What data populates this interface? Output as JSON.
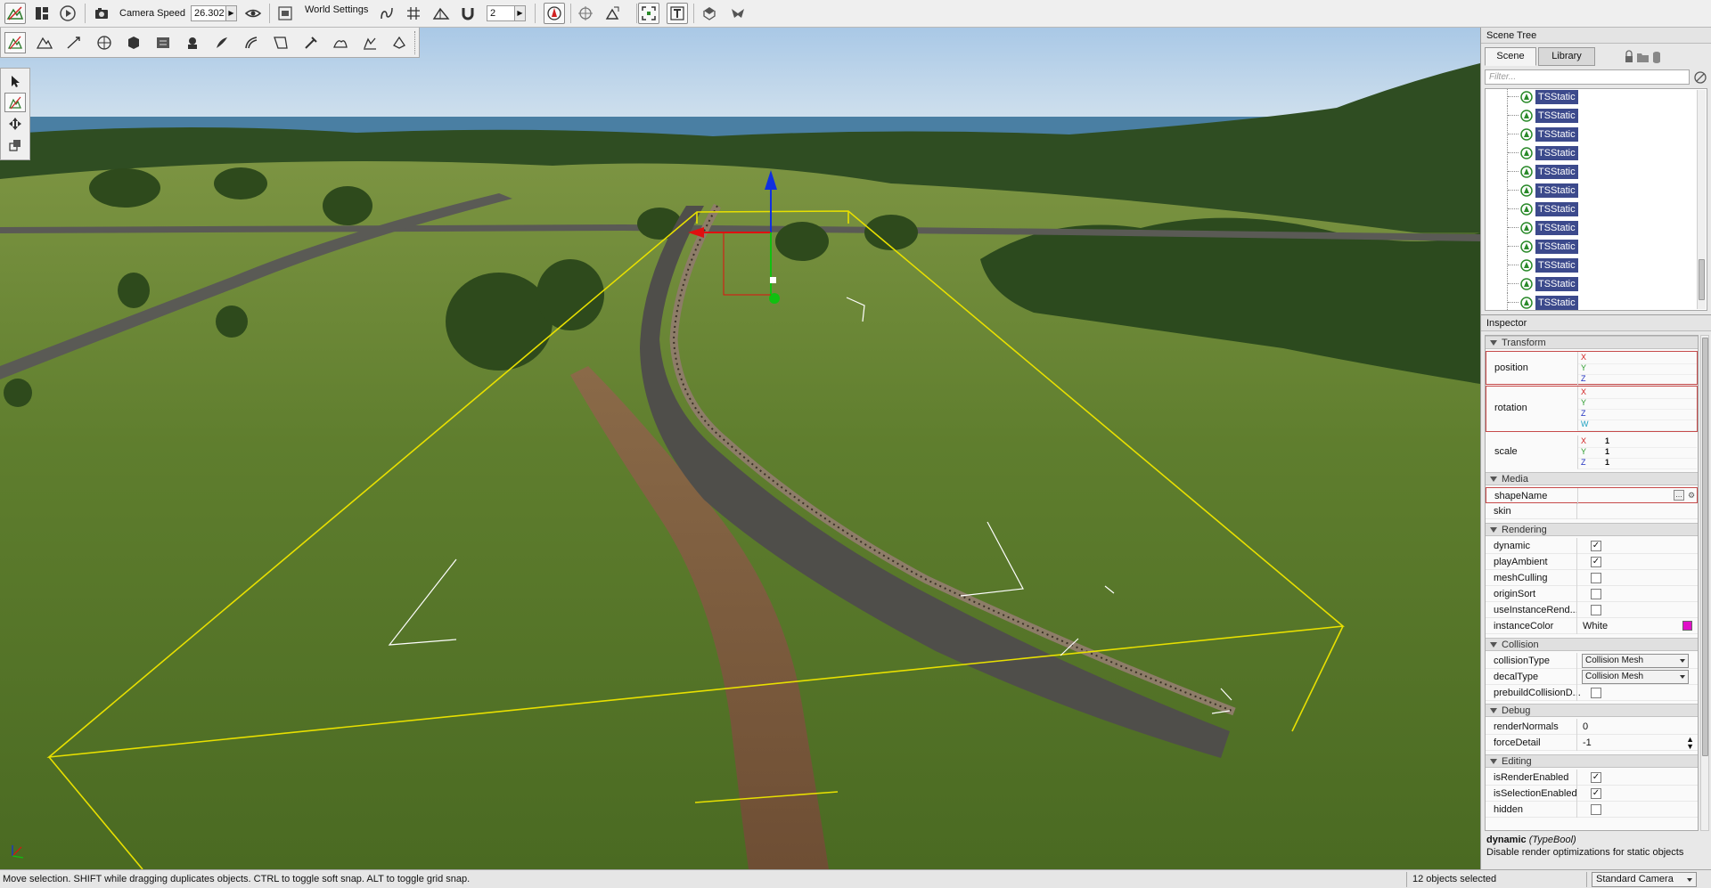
{
  "toolbar": {
    "camera_speed_label": "Camera Speed",
    "camera_speed_value": "26.302",
    "world_settings_label": "World Settings",
    "snap_value": "2"
  },
  "scene_tree": {
    "title": "Scene Tree",
    "tabs": [
      "Scene",
      "Library"
    ],
    "filter_placeholder": "Filter...",
    "items": [
      "TSStatic",
      "TSStatic",
      "TSStatic",
      "TSStatic",
      "TSStatic",
      "TSStatic",
      "TSStatic",
      "TSStatic",
      "TSStatic",
      "TSStatic",
      "TSStatic",
      "TSStatic"
    ]
  },
  "inspector": {
    "title": "Inspector",
    "sections": {
      "transform": "Transform",
      "media": "Media",
      "rendering": "Rendering",
      "collision": "Collision",
      "debug": "Debug",
      "editing": "Editing"
    },
    "position": {
      "label": "position",
      "x": "",
      "y": "",
      "z": ""
    },
    "rotation": {
      "label": "rotation",
      "x": "",
      "y": "",
      "z": "",
      "w": ""
    },
    "scale": {
      "label": "scale",
      "x": "1",
      "y": "1",
      "z": "1"
    },
    "axis_labels": {
      "x": "X",
      "y": "Y",
      "z": "Z",
      "w": "W"
    },
    "media": {
      "shape_name_label": "shapeName",
      "shape_name_value": "",
      "skin_label": "skin",
      "skin_value": ""
    },
    "rendering": {
      "dynamic_label": "dynamic",
      "dynamic": true,
      "play_ambient_label": "playAmbient",
      "play_ambient": true,
      "mesh_culling_label": "meshCulling",
      "mesh_culling": false,
      "origin_sort_label": "originSort",
      "origin_sort": false,
      "use_instance_render_label": "useInstanceRend...",
      "use_instance_render": false,
      "instance_color_label": "instanceColor",
      "instance_color_value": "White",
      "instance_color_swatch": "#e010c8"
    },
    "collision": {
      "collision_type_label": "collisionType",
      "collision_type_value": "Collision Mesh",
      "decal_type_label": "decalType",
      "decal_type_value": "Collision Mesh",
      "prebuild_label": "prebuildCollisionD...",
      "prebuild": false
    },
    "debug": {
      "render_normals_label": "renderNormals",
      "render_normals_value": "0",
      "force_detail_label": "forceDetail",
      "force_detail_value": "-1"
    },
    "editing": {
      "is_render_enabled_label": "isRenderEnabled",
      "is_render_enabled": true,
      "is_selection_enabled_label": "isSelectionEnabled",
      "is_selection_enabled": true,
      "hidden_label": "hidden",
      "hidden": false
    },
    "description": {
      "name": "dynamic",
      "type": "(TypeBool)",
      "text": "Disable render optimizations for static objects"
    }
  },
  "status": {
    "message": "Move selection.  SHIFT while dragging duplicates objects.  CTRL to toggle soft snap.  ALT to toggle grid snap.",
    "selection_count": "12 objects selected",
    "camera_mode": "Standard Camera"
  },
  "colors": {
    "selection_box": "#e8e000",
    "tree_highlight": "#3c4a8c",
    "gizmo_x": "#e01010",
    "gizmo_y": "#10c010",
    "gizmo_z": "#1030e0"
  }
}
